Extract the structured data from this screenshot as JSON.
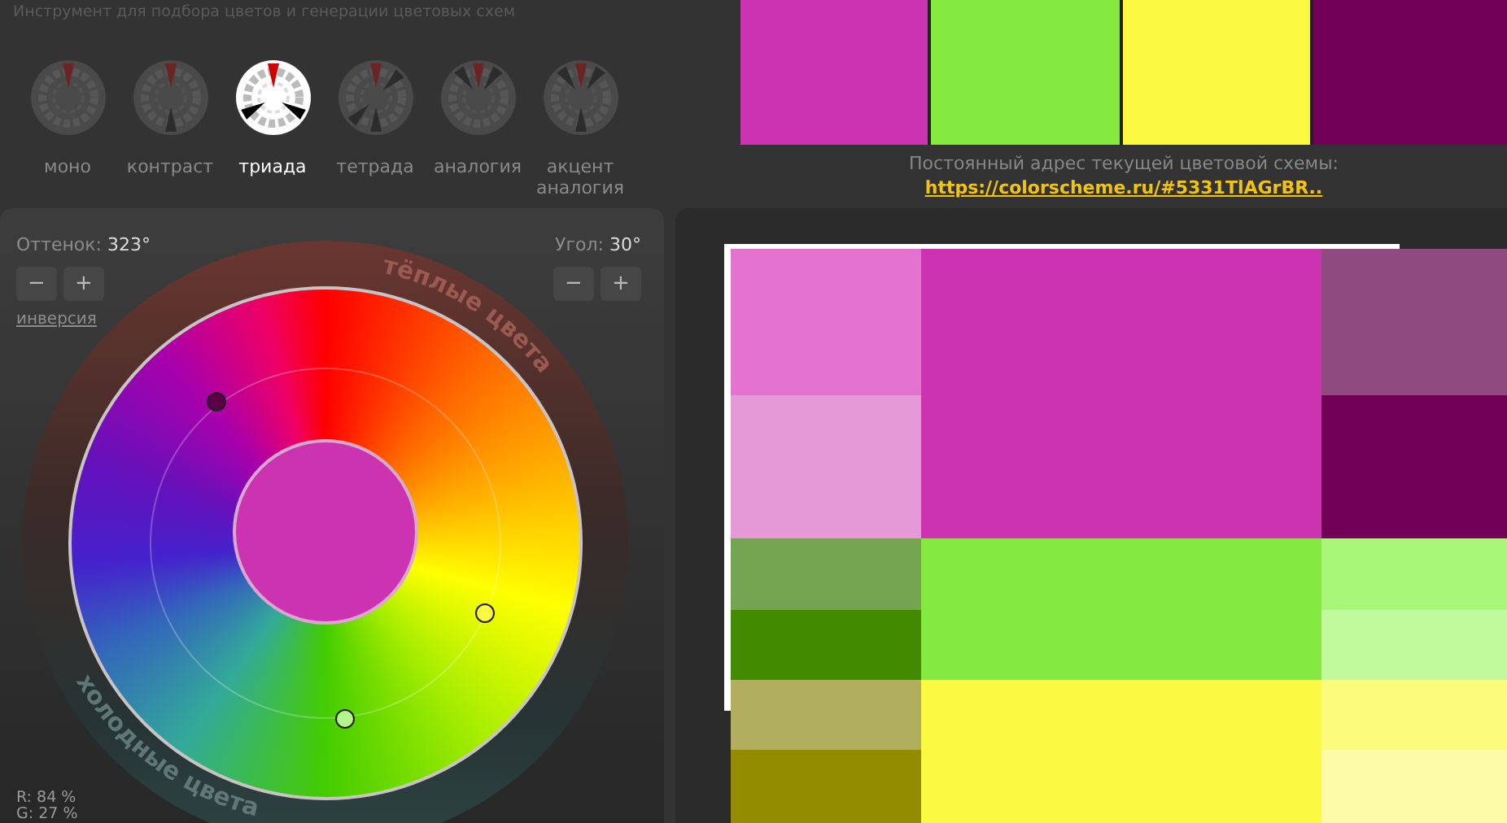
{
  "header": {
    "title": "Инструмент для подбора цветов и генерации цветовых схем"
  },
  "schemes": [
    {
      "label": "моно",
      "selected": false
    },
    {
      "label": "контраст",
      "selected": false
    },
    {
      "label": "триада",
      "selected": true
    },
    {
      "label": "тетрада",
      "selected": false
    },
    {
      "label": "аналогия",
      "selected": false
    },
    {
      "label": "акцент аналогия",
      "selected": false
    }
  ],
  "swatches": [
    {
      "color": "#cc33b0"
    },
    {
      "color": "#84ea40"
    },
    {
      "color": "#fcf942"
    },
    {
      "color": "#720058"
    }
  ],
  "permalink": {
    "label": "Постоянный адрес текущей цветовой схемы:",
    "url": "https://colorscheme.ru/#5331TlAGrBR.."
  },
  "hue": {
    "label": "Оттенок:",
    "value": "323°",
    "minus": "−",
    "plus": "+"
  },
  "angle": {
    "label": "Угол:",
    "value": "30°",
    "minus": "−",
    "plus": "+"
  },
  "inversion": "инверсия",
  "wheel": {
    "warm_label": "тёплые цвета",
    "cold_label": "холодные цвета",
    "markers": [
      {
        "color": "#5a0048"
      },
      {
        "color": "#fcf942"
      },
      {
        "color": "#b5f58e"
      }
    ]
  },
  "readouts": [
    "R: 84 %",
    "G: 27 %"
  ],
  "preview": {
    "rows": [
      {
        "left": [
          {
            "color": "#e473cf"
          },
          {
            "color": "#e49ad5"
          }
        ],
        "center": {
          "color": "#cc33b0"
        },
        "right": [
          {
            "color": "#8f4b80"
          },
          {
            "color": "#720058"
          }
        ]
      },
      {
        "left": [
          {
            "color": "#75a550"
          },
          {
            "color": "#428a00"
          }
        ],
        "center": {
          "color": "#84ea40"
        },
        "right": [
          {
            "color": "#a8f779"
          },
          {
            "color": "#c1f99d"
          }
        ]
      },
      {
        "left": [
          {
            "color": "#b2ae5f"
          },
          {
            "color": "#948c00"
          }
        ],
        "center": {
          "color": "#fcf942"
        },
        "right": [
          {
            "color": "#fdfb7c"
          },
          {
            "color": "#fdfba5"
          }
        ]
      }
    ]
  }
}
